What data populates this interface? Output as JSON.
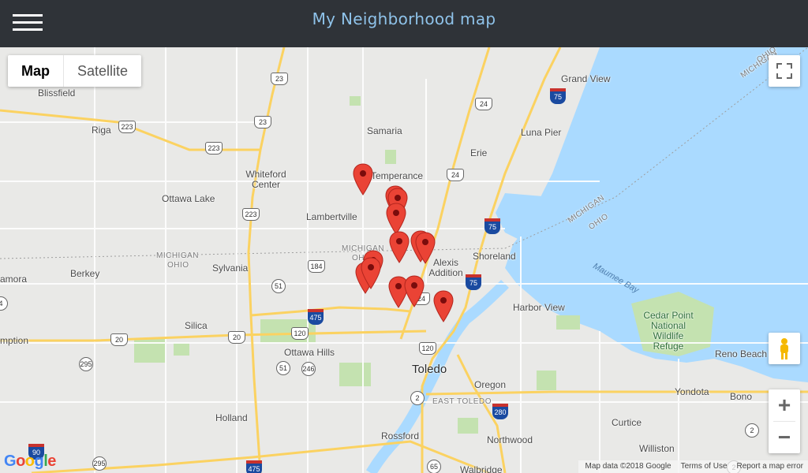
{
  "header": {
    "title": "My Neighborhood map",
    "menu_icon": "hamburger-menu-icon"
  },
  "map_type": {
    "options": [
      "Map",
      "Satellite"
    ],
    "selected": "Map"
  },
  "colors": {
    "header_bg": "#2f3338",
    "title": "#8fc3ea",
    "water": "#aadaff",
    "land": "#e9e9e7",
    "park": "#c4e2b0",
    "highway": "#fbd261",
    "marker": "#ea4335"
  },
  "place_labels": [
    "Blissfield",
    "Riga",
    "Samaria",
    "Erie",
    "Luna Pier",
    "Grand View",
    "Whiteford Center",
    "Temperance",
    "Ottawa Lake",
    "Lambertville",
    "Shoreland",
    "Alexis Addition",
    "Sylvania",
    "Berkey",
    "amora",
    "Silica",
    "mption",
    "Ottawa Hills",
    "Toledo",
    "Harbor View",
    "Holland",
    "Oregon",
    "EAST TOLEDO",
    "Rossford",
    "Northwood",
    "Walbridge",
    "Curtice",
    "Williston",
    "Reno Beach",
    "Yondota",
    "Bono"
  ],
  "state_labels": [
    "MICHIGAN",
    "OHIO",
    "MICHIGAN",
    "OHIO",
    "MICHIGAN",
    "OHIO",
    "MICHIGAN",
    "OHIO"
  ],
  "water_labels": [
    "Maumee Bay"
  ],
  "park_labels": [
    "Cedar Point National Wildlife Refuge"
  ],
  "route_labels": [
    "23",
    "223",
    "23",
    "223",
    "24",
    "75",
    "24",
    "223",
    "75",
    "184",
    "51",
    "75",
    "475",
    "120",
    "20",
    "20",
    "246",
    "295",
    "24",
    "120",
    "51",
    "2",
    "2",
    "280",
    "65",
    "295",
    "475",
    "2",
    "90",
    "4"
  ],
  "markers_count": 13,
  "controls": {
    "fullscreen_icon": "fullscreen-icon",
    "pegman_icon": "street-view-pegman-icon",
    "zoom_in": "+",
    "zoom_out": "−"
  },
  "footer": {
    "map_data": "Map data ©2018 Google",
    "terms": "Terms of Use",
    "report": "Report a map error"
  },
  "google_logo": "Google"
}
